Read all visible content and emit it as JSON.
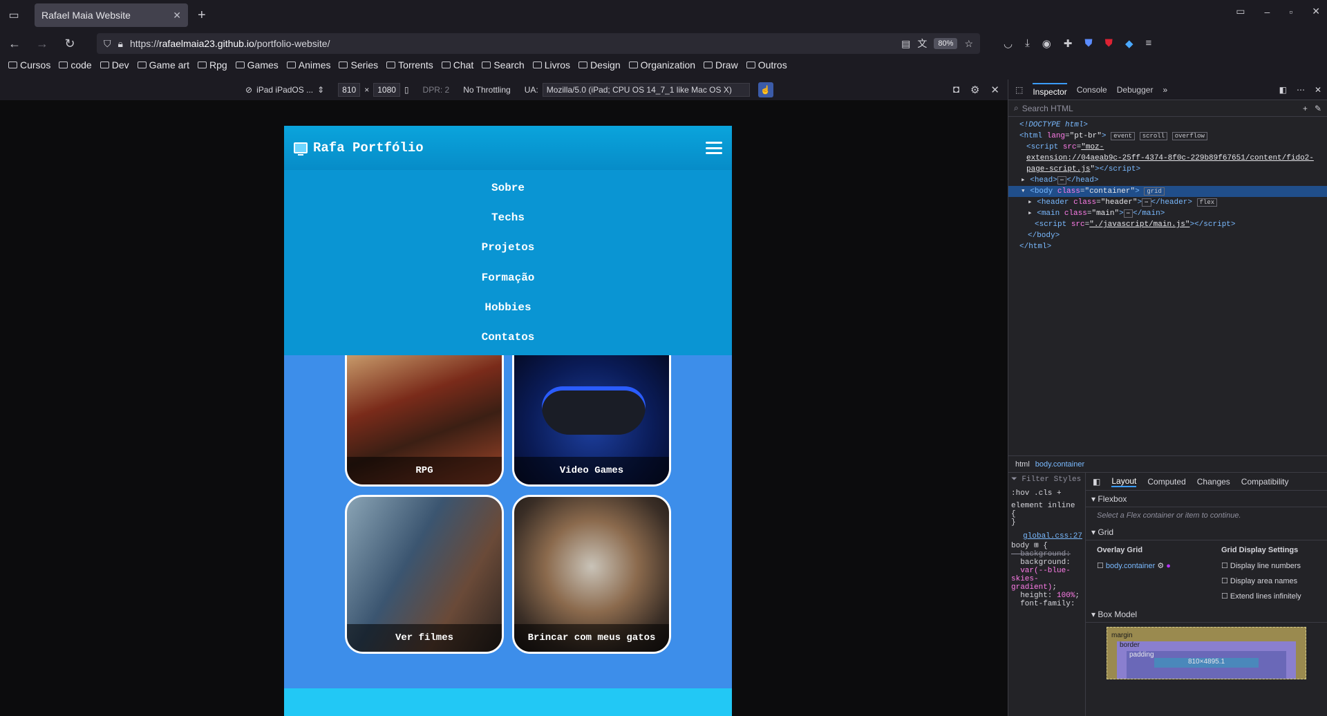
{
  "browser": {
    "tab_title": "Rafael Maia Website",
    "url_prefix": "https://",
    "url_host": "rafaelmaia23.github.io",
    "url_path": "/portfolio-website/",
    "zoom": "80%"
  },
  "bookmarks": [
    "Cursos",
    "code",
    "Dev",
    "Game art",
    "Rpg",
    "Games",
    "Animes",
    "Series",
    "Torrents",
    "Chat",
    "Search",
    "Livros",
    "Design",
    "Organization",
    "Draw",
    "Outros"
  ],
  "rdm": {
    "device": "iPad iPadOS ...",
    "width": "810",
    "height": "1080",
    "dpr": "DPR: 2",
    "throttling": "No Throttling",
    "ua_label": "UA:",
    "ua": "Mozilla/5.0 (iPad; CPU OS 14_7_1 like Mac OS X)"
  },
  "site": {
    "logo_text": "Rafa Portfólio",
    "menu": [
      "Sobre",
      "Techs",
      "Projetos",
      "Formação",
      "Hobbies",
      "Contatos"
    ],
    "cards": [
      "RPG",
      "Video Games",
      "Ver filmes",
      "Brincar com meus gatos"
    ]
  },
  "devtools": {
    "tabs": [
      "Inspector",
      "Console",
      "Debugger"
    ],
    "search_placeholder": "Search HTML",
    "breadcrumbs": [
      "html",
      "body.container"
    ],
    "style_tabs": [
      "Layout",
      "Computed",
      "Changes",
      "Compatibility"
    ],
    "filter_placeholder": "Filter Styles",
    "flexbox_title": "Flexbox",
    "flexbox_hint": "Select a Flex container or item to continue.",
    "grid_title": "Grid",
    "overlay_grid": "Overlay Grid",
    "grid_item": "body.container",
    "grid_settings": "Grid Display Settings",
    "grid_options": [
      "Display line numbers",
      "Display area names",
      "Extend lines infinitely"
    ],
    "boxmodel_title": "Box Model",
    "box_size": "810×4895.1",
    "rule_file": "global.css:27"
  }
}
